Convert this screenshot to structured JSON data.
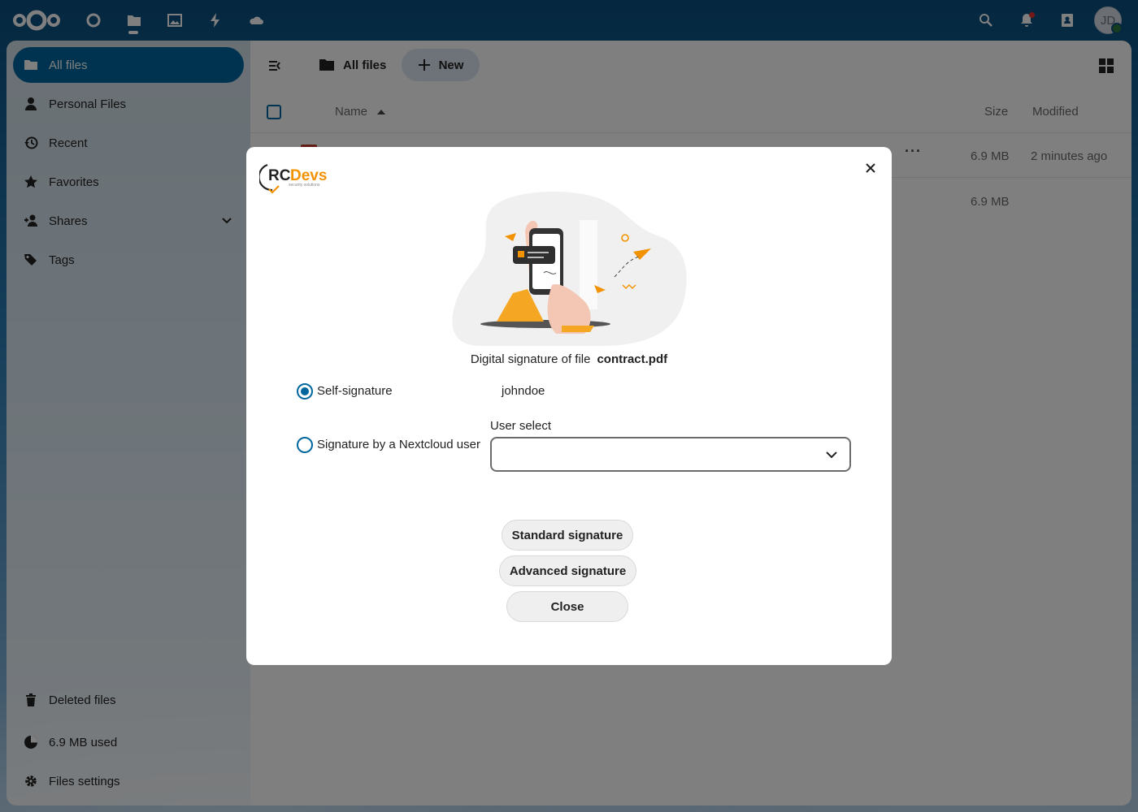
{
  "header": {
    "apps": [
      {
        "name": "dashboard-icon"
      },
      {
        "name": "files-icon"
      },
      {
        "name": "photos-icon"
      },
      {
        "name": "activity-icon"
      },
      {
        "name": "cloud-icon"
      }
    ],
    "avatar_initials": "JD"
  },
  "sidebar": {
    "items": [
      {
        "label": "All files",
        "icon": "folder-icon"
      },
      {
        "label": "Personal Files",
        "icon": "user-icon"
      },
      {
        "label": "Recent",
        "icon": "history-icon"
      },
      {
        "label": "Favorites",
        "icon": "star-icon"
      },
      {
        "label": "Shares",
        "icon": "share-icon"
      },
      {
        "label": "Tags",
        "icon": "tag-icon"
      }
    ],
    "bottom": {
      "deleted": "Deleted files",
      "quota": "6.9 MB used",
      "settings": "Files settings"
    }
  },
  "main": {
    "breadcrumb": "All files",
    "new_label": "New",
    "columns": {
      "name": "Name",
      "size": "Size",
      "modified": "Modified"
    },
    "rows": [
      {
        "size": "6.9 MB",
        "modified": "2 minutes ago"
      },
      {
        "size": "6.9 MB",
        "modified": ""
      }
    ]
  },
  "modal": {
    "logo_text": "RCDevs",
    "logo_rc": "RC",
    "logo_devs": "Devs",
    "logo_tagline": "security solutions",
    "file_prefix": "Digital signature of file",
    "file_name": "contract.pdf",
    "option_self": "Self-signature",
    "self_user": "johndoe",
    "option_user": "Signature by a Nextcloud user",
    "user_select_label": "User select",
    "user_select_value": "",
    "buttons": {
      "standard": "Standard signature",
      "advanced": "Advanced signature",
      "close": "Close"
    }
  },
  "colors": {
    "primary": "#00679e",
    "accent_orange": "#f39200"
  }
}
